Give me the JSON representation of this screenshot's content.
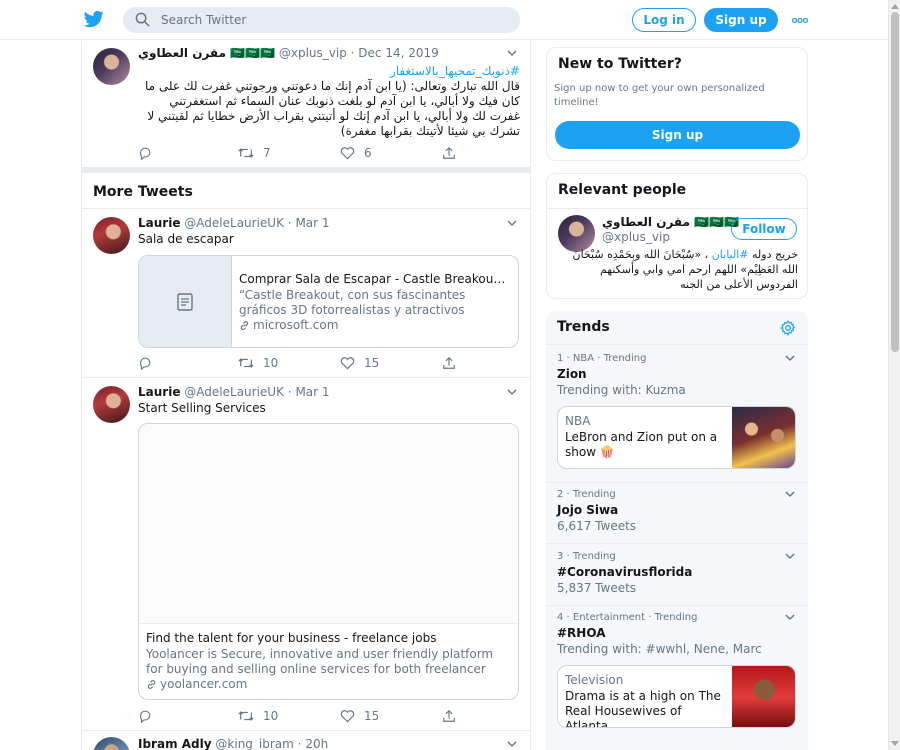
{
  "colors": {
    "accent": "#1da1f2",
    "muted": "#657786",
    "text": "#14171a",
    "border": "#e6ecf0"
  },
  "header": {
    "logo_icon": "twitter-bird-icon",
    "search_placeholder": "Search Twitter",
    "login_label": "Log in",
    "signup_label": "Sign up",
    "more_icon": "more-dots-icon"
  },
  "top_tweet": {
    "name": "مقرن العطاوي 🇸🇦🇸🇦🇸🇦",
    "handle": "@xplus_vip",
    "date": "Dec 14, 2019",
    "hashtag": "#ذنوبك_تمحيها_بالاستغفار",
    "text": "قال الله تبارك وتعالى: (يا ابن آدم إنك ما دعوتني ورجوتني غفرت لك على ما كان فيك ولا أبالي، يا ابن آدم لو بلغت ذنوبك عنان السماء ثم استغفرتني غفرت لك ولا أبالي، يا ابن آدم إنك لو أتيتني بقراب الأرض خطايا ثم لقيتني لا تشرك بي شيئا لأتيتك بقرابها مغفرة)",
    "retweets": "7",
    "likes": "6"
  },
  "more_tweets_title": "More Tweets",
  "tweets": [
    {
      "name": "Laurie",
      "handle": "@AdeleLaurieUK",
      "date": "Mar 1",
      "text": "Sala de escapar",
      "card": {
        "title": "Comprar Sala de Escapar - Castle Breakout - Microsoft Store es-ES",
        "description": "“Castle Breakout, con sus fascinantes gráficos 3D fotorrealistas y atractivos conjuntos de acertijos",
        "domain": "microsoft.com"
      },
      "retweets": "10",
      "likes": "15"
    },
    {
      "name": "Laurie",
      "handle": "@AdeleLaurieUK",
      "date": "Mar 1",
      "text": "Start Selling Services",
      "card": {
        "title": "Find the talent for your business - freelance jobs",
        "description": "Yoolancer is Secure, innovative and user friendly platform for buying and selling online services for both freelancer and employers",
        "domain": "yoolancer.com"
      },
      "retweets": "10",
      "likes": "15"
    },
    {
      "name": "Ibram Adly",
      "handle": "@king_ibram",
      "date": "20h"
    }
  ],
  "new_to_twitter": {
    "title": "New to Twitter?",
    "subtitle": "Sign up now to get your own personalized timeline!",
    "button": "Sign up"
  },
  "relevant_people": {
    "title": "Relevant people",
    "name": "مقرن العطاوي 🇸🇦🇸🇦🇸🇦",
    "handle": "@xplus_vip",
    "follow": "Follow",
    "bio_prefix": "خريج دوله ",
    "bio_hashtag": "#اليابان",
    "bio_suffix": " ، «سُبْحَانَ الله وبِحَمْدِه سُبْحَانَ الله العَظِيْم» اللهم ارحم امي وابي وأسكنهم الفردوس الأعلى من الجنه"
  },
  "trends": {
    "title": "Trends",
    "items": [
      {
        "meta": "1 · NBA · Trending",
        "name": "Zion",
        "sub": "Trending with: Kuzma",
        "card": {
          "category": "NBA",
          "headline": "LeBron and Zion put on a show 🍿"
        }
      },
      {
        "meta": "2 · Trending",
        "name": "Jojo Siwa",
        "sub": "6,617 Tweets"
      },
      {
        "meta": "3 · Trending",
        "name": "#Coronavirusflorida",
        "sub": "5,837 Tweets"
      },
      {
        "meta": "4 · Entertainment · Trending",
        "name": "#RHOA",
        "sub": "Trending with: #wwhl, Nene, Marc",
        "card": {
          "category": "Television",
          "headline": "Drama is at a high on The Real Housewives of Atlanta"
        }
      }
    ]
  }
}
